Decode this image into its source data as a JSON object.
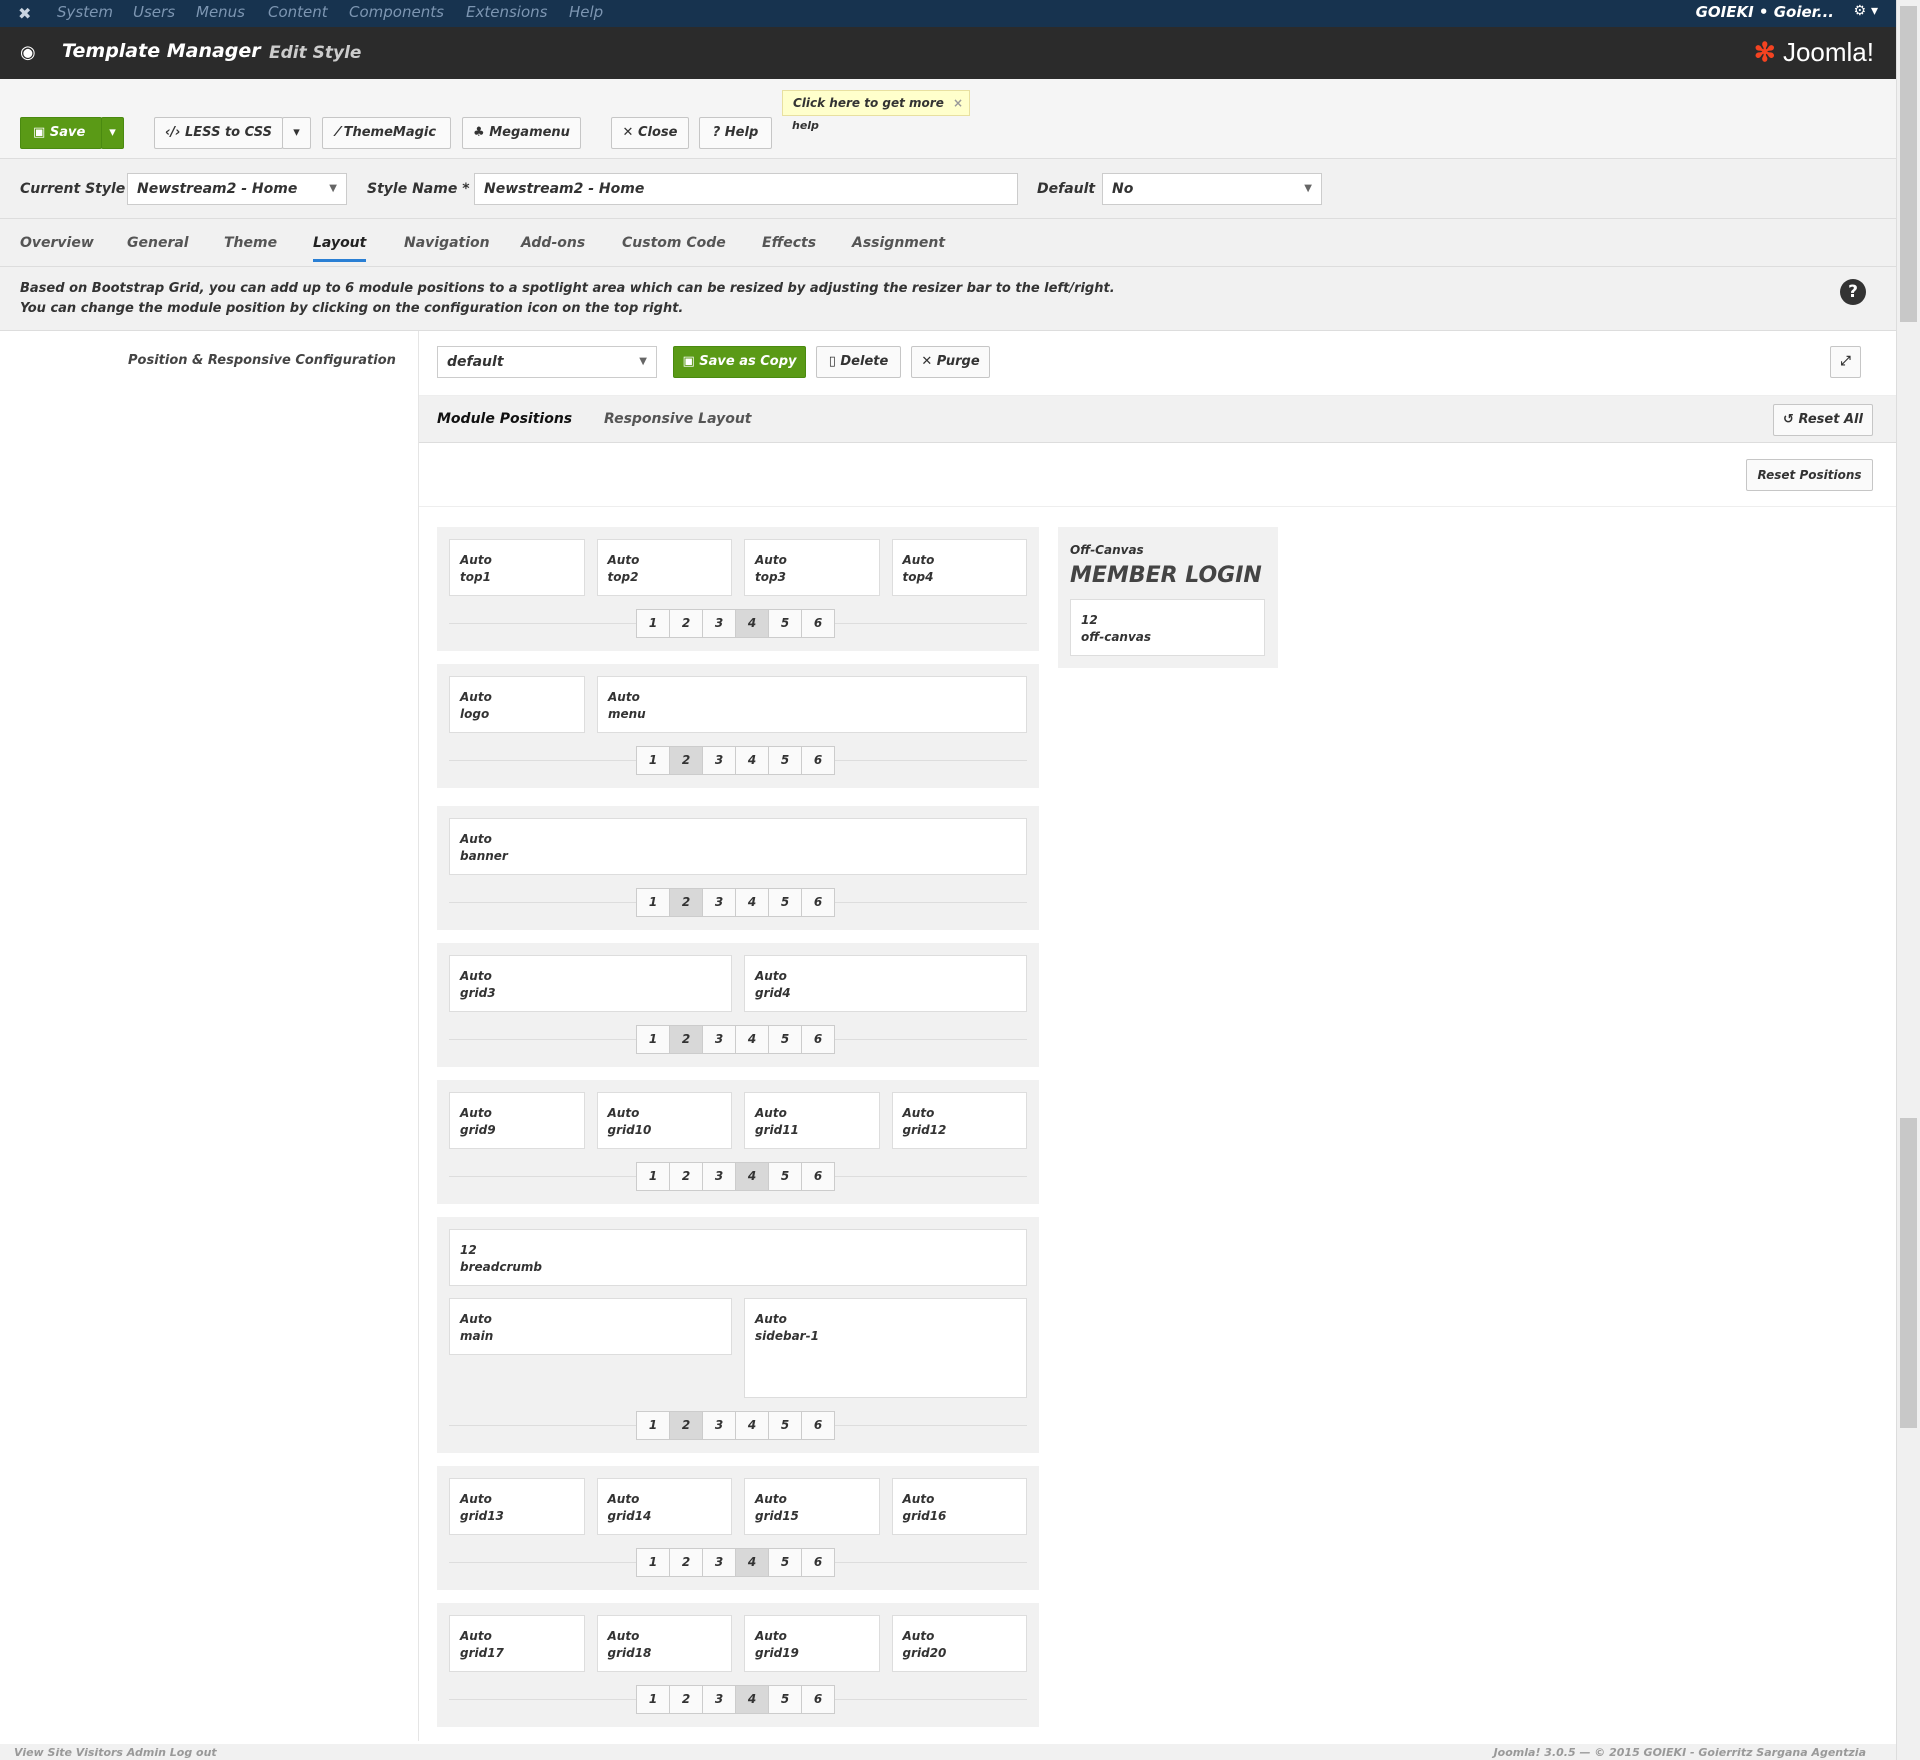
{
  "menubar": {
    "items": [
      "System",
      "Users",
      "Menus",
      "Content",
      "Components",
      "Extensions",
      "Help"
    ],
    "user": "GOIEKI • Goier...",
    "logo_icon": "joomla-icon",
    "settings_icon": "gear-icon"
  },
  "titlebar": {
    "title": "Template Manager",
    "subtitle": "Edit Style",
    "brand": "Joomla!"
  },
  "toolbar": {
    "save": "Save",
    "less_to_css": "LESS to CSS",
    "thememagic": "ThemeMagic",
    "megamenu": "Megamenu",
    "close": "Close",
    "help": "Help",
    "tooltip": "Click here to get more",
    "tooltip_more": "help"
  },
  "style": {
    "current_style_label": "Current Style",
    "current_style_value": "Newstream2 - Home",
    "style_name_label": "Style Name *",
    "style_name_value": "Newstream2 - Home",
    "default_label": "Default",
    "default_value": "No"
  },
  "tabs": [
    "Overview",
    "General",
    "Theme",
    "Layout",
    "Navigation",
    "Add-ons",
    "Custom Code",
    "Effects",
    "Assignment"
  ],
  "active_tab": "Layout",
  "info": {
    "line1": "Based on Bootstrap Grid, you can add up to 6 module positions to a spotlight area which can be resized by adjusting the resizer bar to the left/right.",
    "line2": "You can change the module position by clicking on the configuration icon on the top right."
  },
  "layout": {
    "section_label": "Position & Responsive Configuration",
    "selected_layout": "default",
    "save_as_copy": "Save as Copy",
    "delete": "Delete",
    "purge": "Purge",
    "subtab_positions": "Module Positions",
    "subtab_responsive": "Responsive Layout",
    "reset_all": "Reset All",
    "reset_positions": "Reset Positions"
  },
  "rows": [
    {
      "positions": [
        [
          "Auto",
          "top1"
        ],
        [
          "Auto",
          "top2"
        ],
        [
          "Auto",
          "top3"
        ],
        [
          "Auto",
          "top4"
        ]
      ],
      "active": 4
    },
    {
      "positions": [
        [
          "Auto",
          "logo"
        ],
        [
          "Auto",
          "menu"
        ]
      ],
      "active": 2
    },
    {
      "positions": [
        [
          "Auto",
          "banner"
        ]
      ],
      "active": 2
    },
    {
      "positions": [
        [
          "Auto",
          "grid3"
        ],
        [
          "Auto",
          "grid4"
        ]
      ],
      "active": 2
    },
    {
      "positions": [
        [
          "Auto",
          "grid9"
        ],
        [
          "Auto",
          "grid10"
        ],
        [
          "Auto",
          "grid11"
        ],
        [
          "Auto",
          "grid12"
        ]
      ],
      "active": 4
    },
    {
      "positions": [
        [
          "12",
          "breadcrumb"
        ],
        [
          "Auto",
          "main"
        ],
        [
          "Auto",
          "sidebar-1"
        ]
      ],
      "active": 2
    },
    {
      "positions": [
        [
          "Auto",
          "grid13"
        ],
        [
          "Auto",
          "grid14"
        ],
        [
          "Auto",
          "grid15"
        ],
        [
          "Auto",
          "grid16"
        ]
      ],
      "active": 4
    },
    {
      "positions": [
        [
          "Auto",
          "grid17"
        ],
        [
          "Auto",
          "grid18"
        ],
        [
          "Auto",
          "grid19"
        ],
        [
          "Auto",
          "grid20"
        ]
      ],
      "active": 4
    }
  ],
  "offcanvas": {
    "label": "Off-Canvas",
    "title": "MEMBER LOGIN",
    "size": "12",
    "position": "off-canvas"
  },
  "numbers": [
    "1",
    "2",
    "3",
    "4",
    "5",
    "6"
  ],
  "footer": {
    "left": "View Site   Visitors   Admin   Log out",
    "right": "Joomla! 3.0.5  — © 2015 GOIEKI - Goierritz Sargana Agentzia"
  }
}
